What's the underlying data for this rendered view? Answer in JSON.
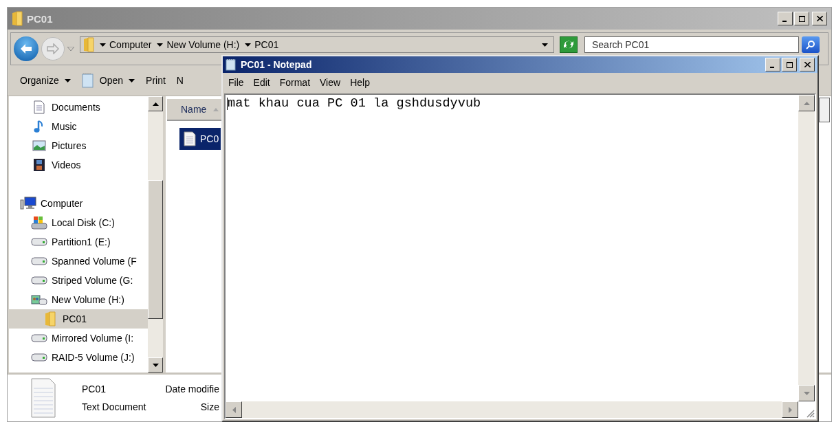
{
  "explorer": {
    "title": "PC01",
    "breadcrumb": [
      "Computer",
      "New Volume (H:)",
      "PC01"
    ],
    "search": {
      "placeholder": "Search PC01"
    },
    "toolbar": [
      {
        "label": "Organize",
        "kind": "menu"
      },
      {
        "label": "Open",
        "kind": "open"
      },
      {
        "label": "Print",
        "kind": "plain"
      },
      {
        "label": "N",
        "kind": "plain"
      }
    ],
    "library_items": [
      {
        "label": "Documents",
        "kind": "documents",
        "selected": false
      },
      {
        "label": "Music",
        "kind": "music",
        "selected": false
      },
      {
        "label": "Pictures",
        "kind": "pictures",
        "selected": false
      },
      {
        "label": "Videos",
        "kind": "videos",
        "selected": false
      }
    ],
    "tree": [
      {
        "label": "Computer",
        "kind": "computer",
        "selected": false,
        "children": [
          {
            "label": "Local Disk (C:)",
            "kind": "system-drive",
            "selected": false
          },
          {
            "label": "Partition1 (E:)",
            "kind": "drive",
            "selected": false
          },
          {
            "label": "Spanned Volume (F",
            "kind": "drive",
            "selected": false
          },
          {
            "label": "Striped Volume (G:",
            "kind": "drive",
            "selected": false
          },
          {
            "label": "New Volume (H:)",
            "kind": "shared-drive",
            "selected": false,
            "children": [
              {
                "label": "PC01",
                "kind": "folder",
                "selected": true
              }
            ]
          },
          {
            "label": "Mirrored Volume (I:",
            "kind": "drive",
            "selected": false
          },
          {
            "label": "RAID-5 Volume (J:)",
            "kind": "drive",
            "selected": false
          }
        ]
      }
    ],
    "columns": [
      {
        "label": "Name",
        "sorted": true
      }
    ],
    "files": [
      {
        "name": "PC0",
        "selected": true
      }
    ],
    "details": {
      "name": "PC01",
      "type": "Text Document",
      "date_label": "Date modifie",
      "size_label": "Size"
    }
  },
  "notepad": {
    "title": "PC01 - Notepad",
    "menu": [
      "File",
      "Edit",
      "Format",
      "View",
      "Help"
    ],
    "text": "mat khau cua PC 01 la gshdusdyvub"
  }
}
